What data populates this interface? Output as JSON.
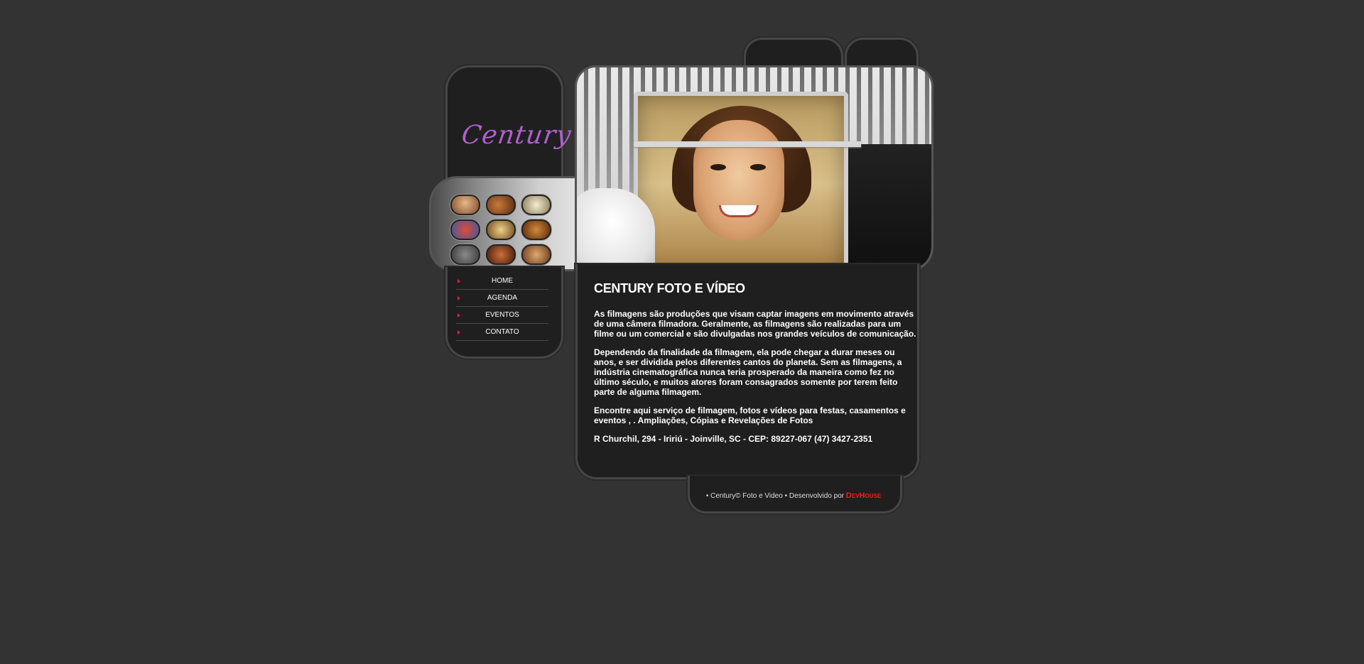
{
  "site": {
    "logo_text": "Century"
  },
  "menu": {
    "items": [
      {
        "label": "HOME"
      },
      {
        "label": "AGENDA"
      },
      {
        "label": "EVENTOS"
      },
      {
        "label": "CONTATO"
      }
    ]
  },
  "gallery": {
    "thumbnails": [
      {
        "icon": "photo-thumb"
      },
      {
        "icon": "photo-thumb"
      },
      {
        "icon": "photo-thumb"
      },
      {
        "icon": "photo-thumb"
      },
      {
        "icon": "photo-thumb"
      },
      {
        "icon": "photo-thumb"
      },
      {
        "icon": "photo-thumb"
      },
      {
        "icon": "photo-thumb"
      },
      {
        "icon": "photo-thumb"
      }
    ]
  },
  "content": {
    "title": "CENTURY FOTO E VÍDEO",
    "paragraphs": [
      "As filmagens são produções que visam captar imagens em movimento através de uma câmera filmadora. Geralmente, as filmagens são realizadas para um filme ou um comercial e são divulgadas nos grandes veículos de comunicação.",
      "Dependendo da finalidade da filmagem, ela pode chegar a durar meses ou anos, e ser dividida pelos diferentes cantos do planeta. Sem as filmagens, a indústria cinematográfica nunca teria prosperado da maneira como fez no último século, e muitos atores foram consagrados somente por terem feito parte de alguma filmagem.",
      "Encontre aqui serviço de filmagem, fotos e vídeos para festas, casamentos e eventos , . Ampliações, Cópias e Revelações de Fotos",
      "R Churchil, 294 - Iririú - Joinville, SC - CEP: 89227-067 (47) 3427-2351"
    ]
  },
  "footer": {
    "text": "• Century© Foto e Video • Desenvolvido por",
    "credit": "DevHouse"
  },
  "colors": {
    "background": "#333333",
    "panel": "#1f1f1f",
    "accent": "#e0213a",
    "logo": "#b05fd0",
    "credit": "#ff1a1a"
  }
}
